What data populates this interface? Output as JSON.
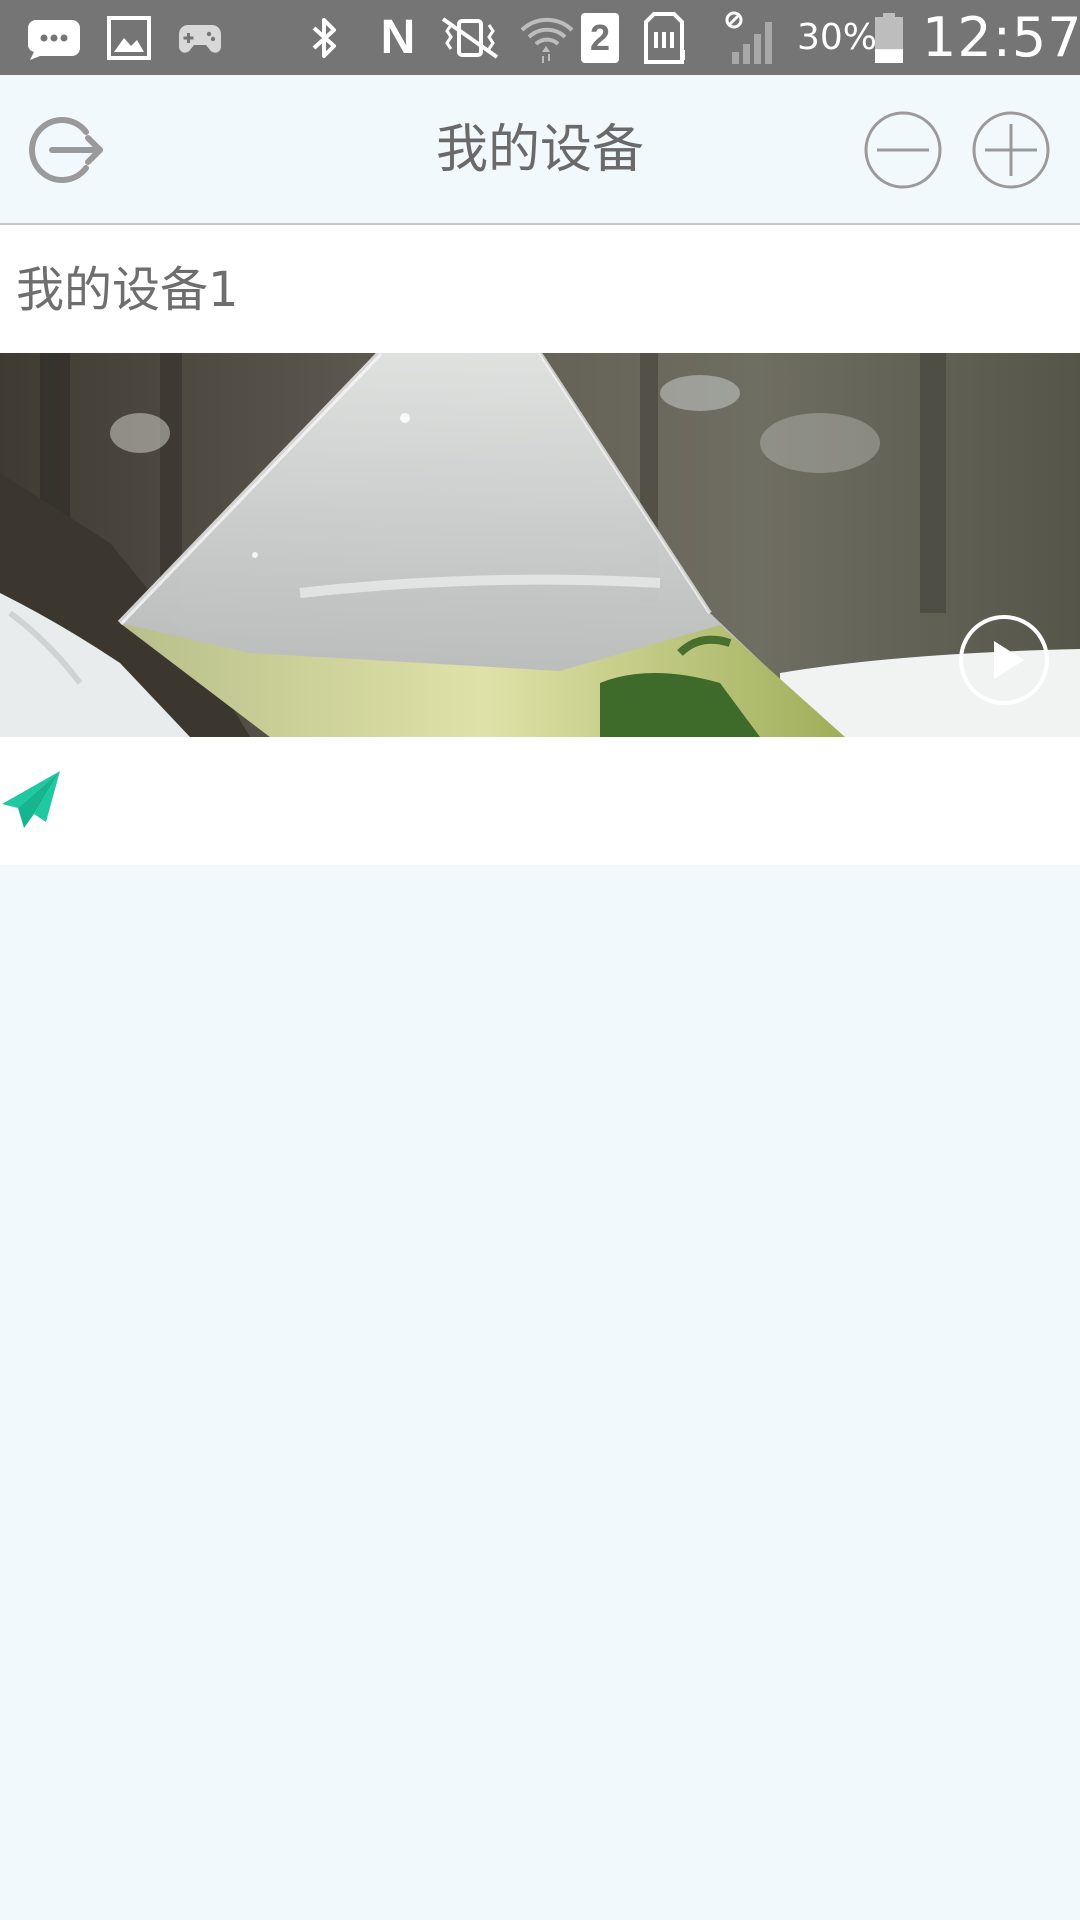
{
  "status_bar": {
    "battery_percent_text": "30%",
    "battery_level": 0.3,
    "time": "12:57",
    "sim_slot_label": "2",
    "network_letter": "N",
    "icons": [
      "chat-icon",
      "gallery-icon",
      "gamepad-icon",
      "bluetooth-icon",
      "nfc-icon",
      "vibrate-icon",
      "wifi-icon",
      "sim2-icon",
      "sd-card-icon",
      "no-signal-icon",
      "battery-icon"
    ]
  },
  "header": {
    "title": "我的设备",
    "icons": [
      "logout-icon",
      "minus-circle-icon",
      "plus-circle-icon"
    ]
  },
  "device_list": {
    "items": [
      {
        "name": "我的设备1",
        "icons": [
          "play-icon",
          "paper-plane-icon"
        ]
      }
    ]
  },
  "colors": {
    "status_bar_bg": "#757575",
    "page_bg": "#f1f9fd",
    "header_icon": "#9a9a9a",
    "title_text": "#6a6a6a",
    "share_accent": "#1ec8a0"
  }
}
